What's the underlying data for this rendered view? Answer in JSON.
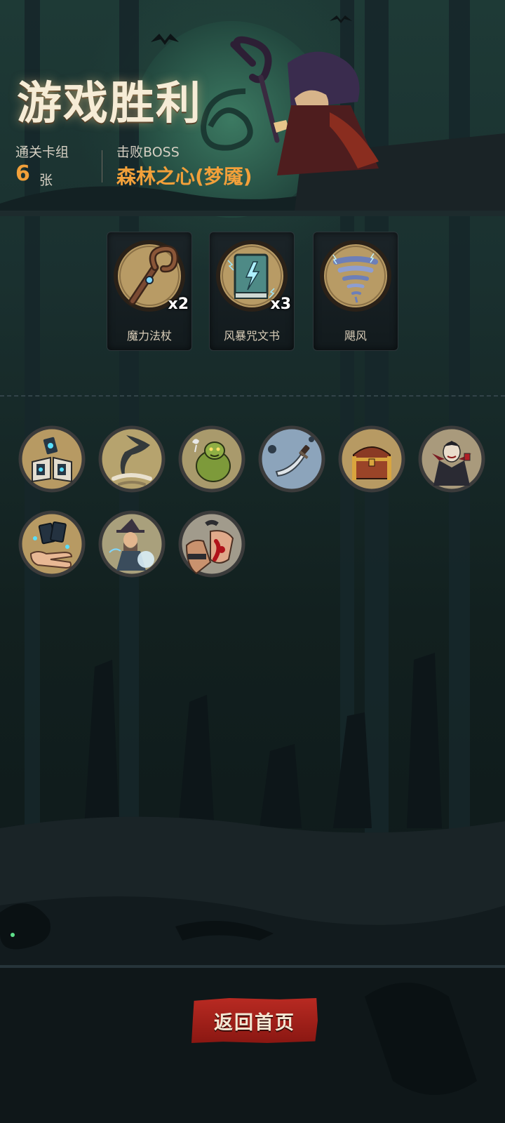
{
  "header": {
    "title": "游戏胜利",
    "deck_label": "通关卡组",
    "deck_count": "6",
    "deck_unit": "张",
    "boss_label": "击败BOSS",
    "boss_name": "森林之心(梦魇)"
  },
  "rewards": [
    {
      "name": "魔力法杖",
      "multiplier": "x2",
      "icon": "magic-staff-icon"
    },
    {
      "name": "风暴咒文书",
      "multiplier": "x3",
      "icon": "storm-spellbook-icon"
    },
    {
      "name": "飓风",
      "multiplier": "",
      "icon": "hurricane-icon"
    }
  ],
  "relics": [
    {
      "icon": "spellbook-cards-icon"
    },
    {
      "icon": "tornado-icon"
    },
    {
      "icon": "ogre-monster-icon"
    },
    {
      "icon": "dagger-icon"
    },
    {
      "icon": "treasure-chest-icon"
    },
    {
      "icon": "vampire-icon"
    },
    {
      "icon": "magic-hand-cards-icon"
    },
    {
      "icon": "wizard-casting-icon"
    },
    {
      "icon": "bloody-fist-icon"
    }
  ],
  "actions": {
    "home_label": "返回首页"
  },
  "colors": {
    "accent_orange": "#f2a03a",
    "button_red": "#b82a22",
    "background": "#0f1a1d"
  }
}
